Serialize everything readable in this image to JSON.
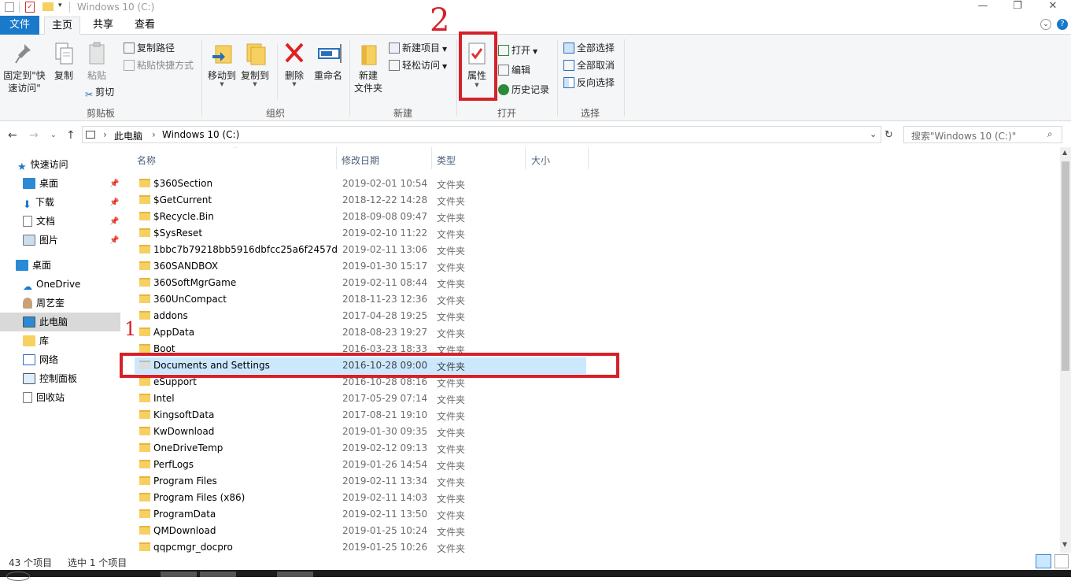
{
  "window": {
    "title": "Windows 10 (C:)",
    "controls": {
      "minimize": "—",
      "maximize": "❐",
      "close": "✕"
    }
  },
  "tabs": [
    {
      "label": "文件"
    },
    {
      "label": "主页"
    },
    {
      "label": "共享"
    },
    {
      "label": "查看"
    }
  ],
  "ribbon": {
    "clipboard": {
      "group_label": "剪贴板",
      "pin_label": "固定到\"快速访问\"",
      "copy_label": "复制",
      "paste_label": "粘贴",
      "copy_path_label": "复制路径",
      "paste_shortcut_label": "粘贴快捷方式",
      "cut_label": "剪切"
    },
    "organize": {
      "group_label": "组织",
      "move_to_label": "移动到",
      "copy_to_label": "复制到",
      "delete_label": "删除",
      "rename_label": "重命名"
    },
    "new": {
      "group_label": "新建",
      "new_folder_label": "新建\n文件夹",
      "new_item_label": "新建项目",
      "easy_access_label": "轻松访问"
    },
    "open": {
      "group_label": "打开",
      "properties_label": "属性",
      "open_label": "打开",
      "edit_label": "编辑",
      "history_label": "历史记录"
    },
    "select": {
      "group_label": "选择",
      "select_all_label": "全部选择",
      "select_none_label": "全部取消",
      "invert_label": "反向选择"
    }
  },
  "address": {
    "crumb_pc": "此电脑",
    "crumb_drive": "Windows 10 (C:)",
    "search_placeholder": "搜索\"Windows 10 (C:)\""
  },
  "nav": {
    "quick_access": "快速访问",
    "desktop_pinned": "桌面",
    "downloads": "下载",
    "documents": "文档",
    "pictures": "图片",
    "desktop": "桌面",
    "onedrive": "OneDrive",
    "user": "周艺奎",
    "this_pc": "此电脑",
    "libraries": "库",
    "network": "网络",
    "control_panel": "控制面板",
    "recycle_bin": "回收站"
  },
  "columns": {
    "name": "名称",
    "date": "修改日期",
    "type": "类型",
    "size": "大小"
  },
  "files": [
    {
      "name": "$360Section",
      "date": "2019-02-01 10:54",
      "type": "文件夹"
    },
    {
      "name": "$GetCurrent",
      "date": "2018-12-22 14:28",
      "type": "文件夹"
    },
    {
      "name": "$Recycle.Bin",
      "date": "2018-09-08 09:47",
      "type": "文件夹"
    },
    {
      "name": "$SysReset",
      "date": "2019-02-10 11:22",
      "type": "文件夹"
    },
    {
      "name": "1bbc7b79218bb5916dbfcc25a6f2457d",
      "date": "2019-02-11 13:06",
      "type": "文件夹"
    },
    {
      "name": "360SANDBOX",
      "date": "2019-01-30 15:17",
      "type": "文件夹"
    },
    {
      "name": "360SoftMgrGame",
      "date": "2019-02-11 08:44",
      "type": "文件夹"
    },
    {
      "name": "360UnCompact",
      "date": "2018-11-23 12:36",
      "type": "文件夹"
    },
    {
      "name": "addons",
      "date": "2017-04-28 19:25",
      "type": "文件夹"
    },
    {
      "name": "AppData",
      "date": "2018-08-23 19:27",
      "type": "文件夹"
    },
    {
      "name": "Boot",
      "date": "2016-03-23 18:33",
      "type": "文件夹"
    },
    {
      "name": "Documents and Settings",
      "date": "2016-10-28 09:00",
      "type": "文件夹"
    },
    {
      "name": "eSupport",
      "date": "2016-10-28 08:16",
      "type": "文件夹"
    },
    {
      "name": "Intel",
      "date": "2017-05-29 07:14",
      "type": "文件夹"
    },
    {
      "name": "KingsoftData",
      "date": "2017-08-21 19:10",
      "type": "文件夹"
    },
    {
      "name": "KwDownload",
      "date": "2019-01-30 09:35",
      "type": "文件夹"
    },
    {
      "name": "OneDriveTemp",
      "date": "2019-02-12 09:13",
      "type": "文件夹"
    },
    {
      "name": "PerfLogs",
      "date": "2019-01-26 14:54",
      "type": "文件夹"
    },
    {
      "name": "Program Files",
      "date": "2019-02-11 13:34",
      "type": "文件夹"
    },
    {
      "name": "Program Files (x86)",
      "date": "2019-02-11 14:03",
      "type": "文件夹"
    },
    {
      "name": "ProgramData",
      "date": "2019-02-11 13:50",
      "type": "文件夹"
    },
    {
      "name": "QMDownload",
      "date": "2019-01-25 10:24",
      "type": "文件夹"
    },
    {
      "name": "qqpcmgr_docpro",
      "date": "2019-01-25 10:26",
      "type": "文件夹"
    }
  ],
  "status": {
    "count": "43 个项目",
    "selected": "选中 1 个项目"
  },
  "annotations": {
    "mark1": "1",
    "mark2": "2"
  },
  "colors": {
    "accent": "#1979ca",
    "selection": "#cce8ff",
    "annotation": "#d4212a",
    "folder": "#f6d162"
  }
}
